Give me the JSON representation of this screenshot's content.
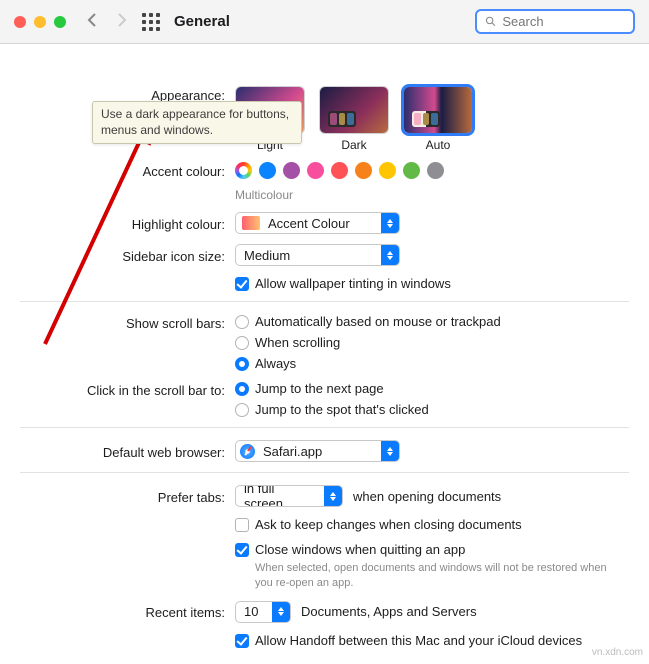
{
  "titlebar": {
    "title": "General",
    "search_placeholder": "Search"
  },
  "tooltip": "Use a dark appearance for buttons, menus and windows.",
  "labels": {
    "appearance": "Appearance:",
    "accent": "Accent colour:",
    "highlight": "Highlight colour:",
    "sidebar_icon": "Sidebar icon size:",
    "show_scroll": "Show scroll bars:",
    "click_scroll": "Click in the scroll bar to:",
    "default_browser": "Default web browser:",
    "prefer_tabs": "Prefer tabs:",
    "recent_items": "Recent items:"
  },
  "appearance": {
    "light": "Light",
    "dark": "Dark",
    "auto": "Auto",
    "selected": "auto"
  },
  "accent": {
    "sublabel": "Multicolour",
    "colors": [
      "#0b84ff",
      "#a550a7",
      "#f74f9e",
      "#ff5257",
      "#f7821b",
      "#ffc600",
      "#62ba46",
      "#8e8e93"
    ]
  },
  "highlight_select": "Accent Colour",
  "sidebar_select": "Medium",
  "wallpaper_tint": {
    "label": "Allow wallpaper tinting in windows",
    "checked": true
  },
  "scroll_bars": {
    "opts": [
      "Automatically based on mouse or trackpad",
      "When scrolling",
      "Always"
    ],
    "selected": 2
  },
  "click_scroll": {
    "opts": [
      "Jump to the next page",
      "Jump to the spot that's clicked"
    ],
    "selected": 0
  },
  "browser_select": "Safari.app",
  "prefer_tabs": {
    "select": "in full screen",
    "suffix": "when opening documents"
  },
  "ask_keep": {
    "label": "Ask to keep changes when closing documents",
    "checked": false
  },
  "close_windows": {
    "label": "Close windows when quitting an app",
    "checked": true,
    "hint": "When selected, open documents and windows will not be restored when you re-open an app."
  },
  "recent": {
    "value": "10",
    "suffix": "Documents, Apps and Servers"
  },
  "handoff": {
    "label": "Allow Handoff between this Mac and your iCloud devices",
    "checked": true
  },
  "watermark": "vn.xdn.com"
}
